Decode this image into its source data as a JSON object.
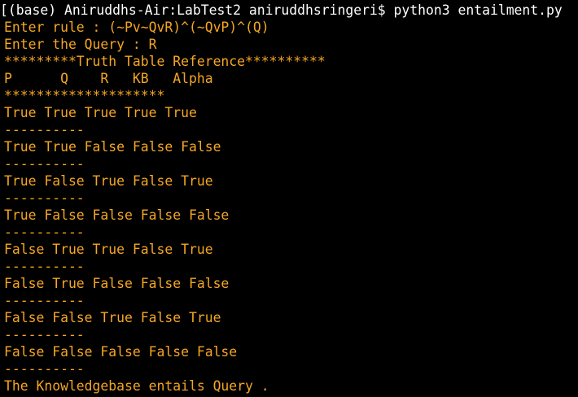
{
  "terminal": {
    "prompt_line": "(base) Aniruddhs-Air:LabTest2 aniruddhsringeri$ python3 entailment.py",
    "prompt_prefix_mark": "[",
    "rule_line": "Enter rule : (~Pv~QvR)^(~QvP)^(Q)",
    "query_line": "Enter the Query : R",
    "truth_table_header": "*********Truth Table Reference**********",
    "columns_line": "P      Q    R   KB   Alpha",
    "stars_line": "********************",
    "rows": [
      "True True True True True",
      "True True False False False",
      "True False True False True",
      "True False False False False",
      "False True True False True",
      "False True False False False",
      "False False True False True",
      "False False False False False"
    ],
    "separator": "----------",
    "conclusion": "The Knowledgebase entails Query ."
  },
  "colors": {
    "background": "#000000",
    "output_text": "#f5a623",
    "prompt_text": "#ffffff"
  }
}
